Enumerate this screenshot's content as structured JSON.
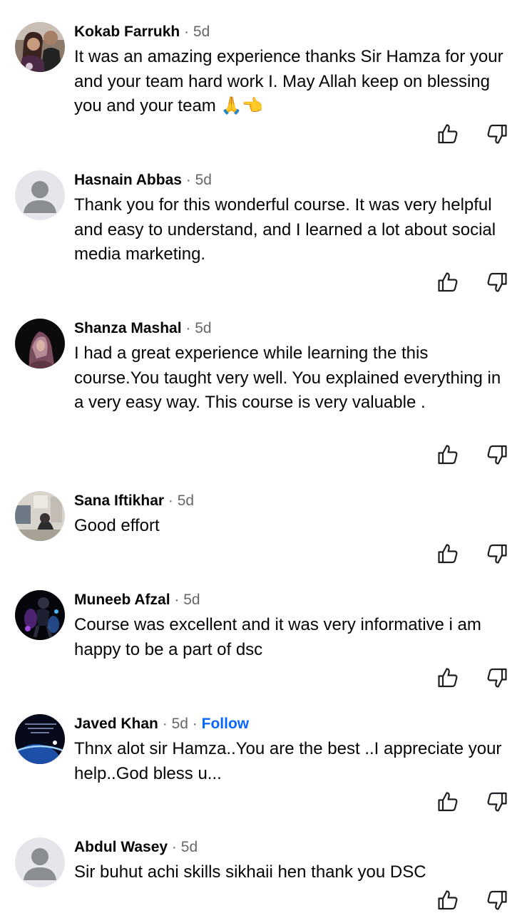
{
  "comments": [
    {
      "author": "Kokab Farrukh",
      "time": "5d",
      "text": "It was an amazing experience thanks Sir Hamza for your and your team hard work I. May Allah keep on blessing you and your team 🙏👈",
      "avatar": "photo"
    },
    {
      "author": "Hasnain Abbas",
      "time": "5d",
      "text": "Thank you for this wonderful course. It was very helpful and easy to understand, and I learned a lot about social media marketing.",
      "avatar": "default"
    },
    {
      "author": "Shanza Mashal",
      "time": "5d",
      "text": "I had a great experience while learning the this course.You taught very well. You explained everything in a very easy way. This course is very valuable .",
      "avatar": "photo"
    },
    {
      "author": "Sana Iftikhar",
      "time": "5d",
      "text": "Good effort",
      "avatar": "photo"
    },
    {
      "author": "Muneeb Afzal",
      "time": "5d",
      "text": "Course was excellent and it was very informative i am happy to be a part of dsc",
      "avatar": "photo"
    },
    {
      "author": "Javed Khan",
      "time": "5d",
      "follow": "Follow",
      "text": "Thnx alot sir Hamza..You are the best ..I appreciate your help..God bless u...",
      "avatar": "photo"
    },
    {
      "author": "Abdul Wasey",
      "time": "5d",
      "text": "Sir buhut achi skills sikhaii hen thank you DSC",
      "avatar": "default"
    }
  ],
  "separator": "·",
  "icons": {
    "like": "thumbs-up-outline-icon",
    "dislike": "thumbs-down-outline-icon",
    "default_avatar": "default-avatar-icon"
  },
  "colors": {
    "text": "#050505",
    "meta": "#65676b",
    "follow": "#0866ff",
    "icon": "#1c1e21"
  }
}
